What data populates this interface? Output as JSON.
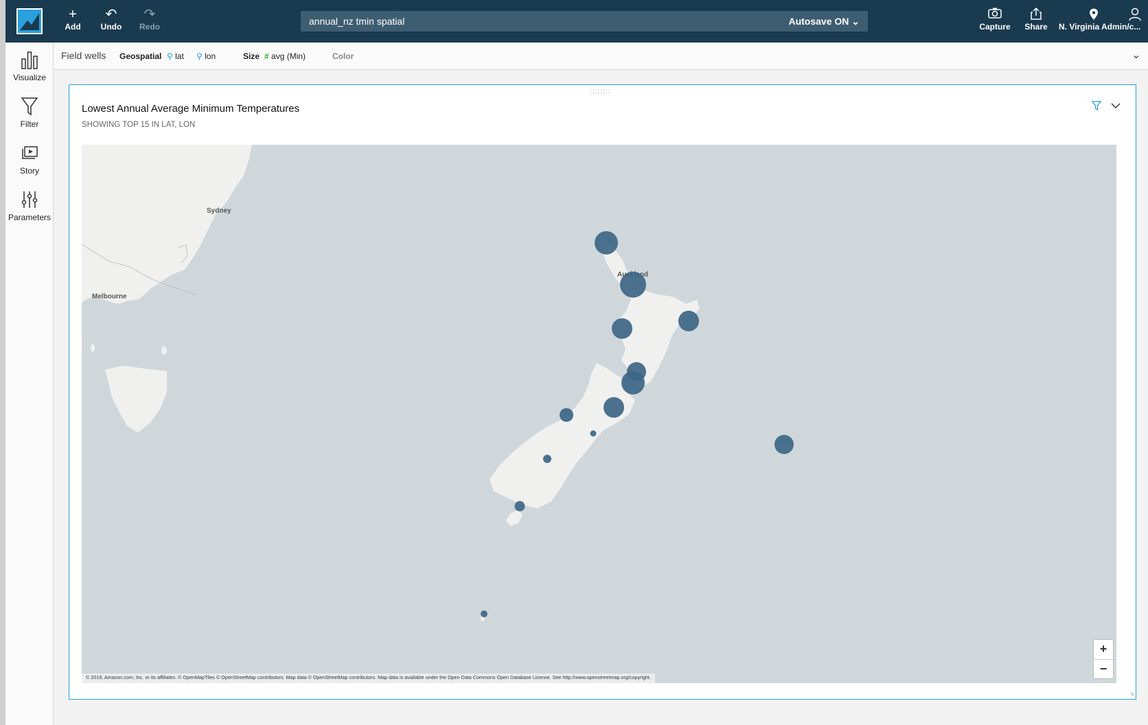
{
  "topbar": {
    "add_label": "Add",
    "undo_label": "Undo",
    "redo_label": "Redo",
    "analysis_title": "annual_nz tmin spatial",
    "autosave_label": "Autosave ON",
    "capture_label": "Capture",
    "share_label": "Share",
    "account_label": "N. Virginia Admin/c...",
    "accent": "#1a3a4f"
  },
  "sidenav": {
    "items": [
      {
        "label": "Visualize",
        "icon": "bar-chart-icon"
      },
      {
        "label": "Filter",
        "icon": "filter-icon"
      },
      {
        "label": "Story",
        "icon": "story-icon"
      },
      {
        "label": "Parameters",
        "icon": "sliders-icon"
      }
    ]
  },
  "fieldwells": {
    "header": "Field wells",
    "geospatial_label": "Geospatial",
    "geo_field_1": "lat",
    "geo_field_2": "lon",
    "size_label": "Size",
    "size_field": "avg (Min)",
    "color_label": "Color"
  },
  "visual": {
    "title": "Lowest Annual Average Minimum Temperatures",
    "subtitle": "SHOWING TOP 15 IN LAT, LON",
    "cities": [
      "Sydney",
      "Melbourne",
      "Auckland"
    ],
    "attribution": "© 2019, Amazon.com, Inc. or its affiliates. © OpenMapTiles © OpenStreetMap contributors. Map data © OpenStreetMap contributors. Map data is available under the Open Data Commons Open Database License. See http://www.openstreetmap.org/copyright.",
    "zoom_in": "+",
    "zoom_out": "−",
    "bubble_color": "#3d6685"
  }
}
